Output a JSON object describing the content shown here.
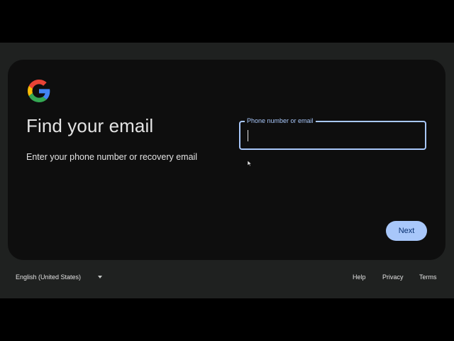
{
  "card": {
    "logo_icon": "google-g-icon",
    "title": "Find your email",
    "subtitle": "Enter your phone number or recovery email"
  },
  "form": {
    "field_label": "Phone number or email",
    "field_value": "",
    "next_label": "Next"
  },
  "footer": {
    "language": "English (United States)",
    "links": [
      "Help",
      "Privacy",
      "Terms"
    ]
  },
  "colors": {
    "page_bg": "#1f2120",
    "card_bg": "#0e0e0e",
    "accent": "#a8c7fa",
    "button_text": "#062e6f",
    "text": "#e3e3e3",
    "google_blue": "#4285F4",
    "google_red": "#EA4335",
    "google_yellow": "#FBBC05",
    "google_green": "#34A853"
  }
}
